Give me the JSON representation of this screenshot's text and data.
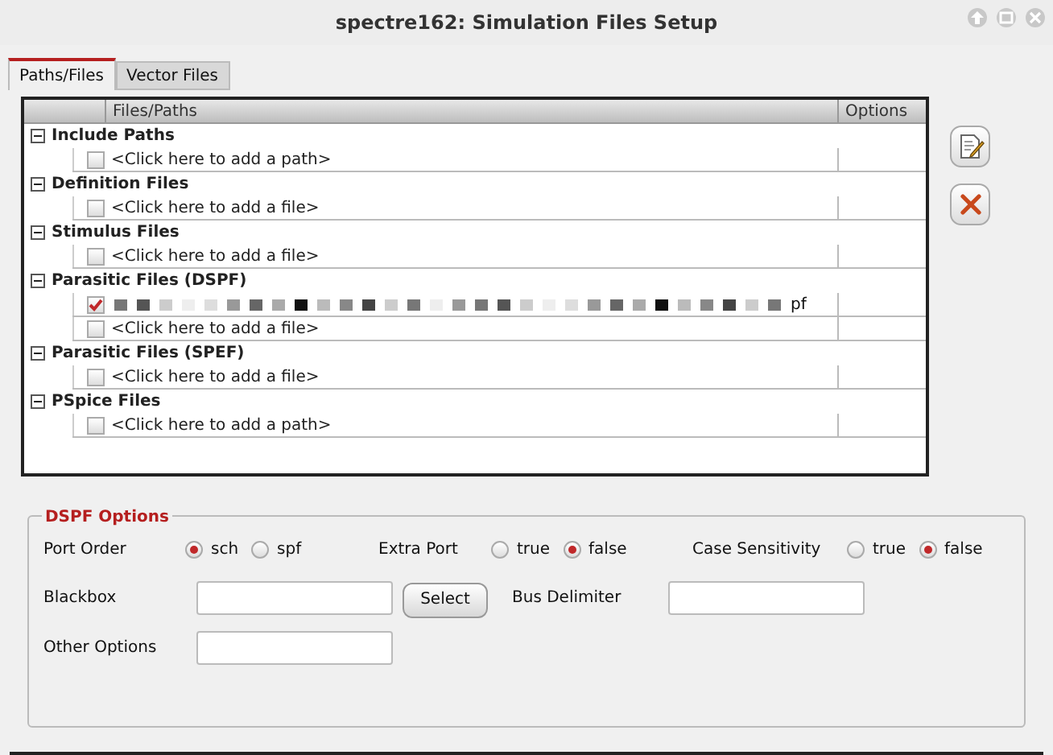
{
  "window": {
    "title": "spectre162: Simulation Files Setup"
  },
  "tabs": [
    {
      "label": "Paths/Files",
      "selected": true
    },
    {
      "label": "Vector Files",
      "selected": false
    }
  ],
  "table": {
    "columns": [
      "Files/Paths",
      "Options"
    ],
    "groups": [
      {
        "label": "Include Paths",
        "expanded": true,
        "children": [
          {
            "kind": "placeholder",
            "text": "<Click here to add a path>",
            "checked": false
          }
        ]
      },
      {
        "label": "Definition Files",
        "expanded": true,
        "children": [
          {
            "kind": "placeholder",
            "text": "<Click here to add a file>",
            "checked": false
          }
        ]
      },
      {
        "label": "Stimulus Files",
        "expanded": true,
        "children": [
          {
            "kind": "placeholder",
            "text": "<Click here to add a file>",
            "checked": false
          }
        ]
      },
      {
        "label": "Parasitic Files (DSPF)",
        "expanded": true,
        "children": [
          {
            "kind": "redacted",
            "text": "pf",
            "checked": true
          },
          {
            "kind": "placeholder",
            "text": "<Click here to add a file>",
            "checked": false
          }
        ]
      },
      {
        "label": "Parasitic Files (SPEF)",
        "expanded": true,
        "children": [
          {
            "kind": "placeholder",
            "text": "<Click here to add a file>",
            "checked": false
          }
        ]
      },
      {
        "label": "PSpice Files",
        "expanded": true,
        "children": [
          {
            "kind": "placeholder",
            "text": "<Click here to add a path>",
            "checked": false
          }
        ]
      }
    ]
  },
  "dspf_options": {
    "title": "DSPF Options",
    "port_order": {
      "label": "Port Order",
      "options": [
        {
          "label": "sch",
          "selected": true
        },
        {
          "label": "spf",
          "selected": false
        }
      ]
    },
    "extra_port": {
      "label": "Extra Port",
      "options": [
        {
          "label": "true",
          "selected": false
        },
        {
          "label": "false",
          "selected": true
        }
      ]
    },
    "case_sensitivity": {
      "label": "Case Sensitivity",
      "options": [
        {
          "label": "true",
          "selected": false
        },
        {
          "label": "false",
          "selected": true
        }
      ]
    },
    "blackbox": {
      "label": "Blackbox",
      "button": "Select"
    },
    "bus_delimiter": {
      "label": "Bus Delimiter"
    },
    "other_options": {
      "label": "Other Options"
    }
  }
}
